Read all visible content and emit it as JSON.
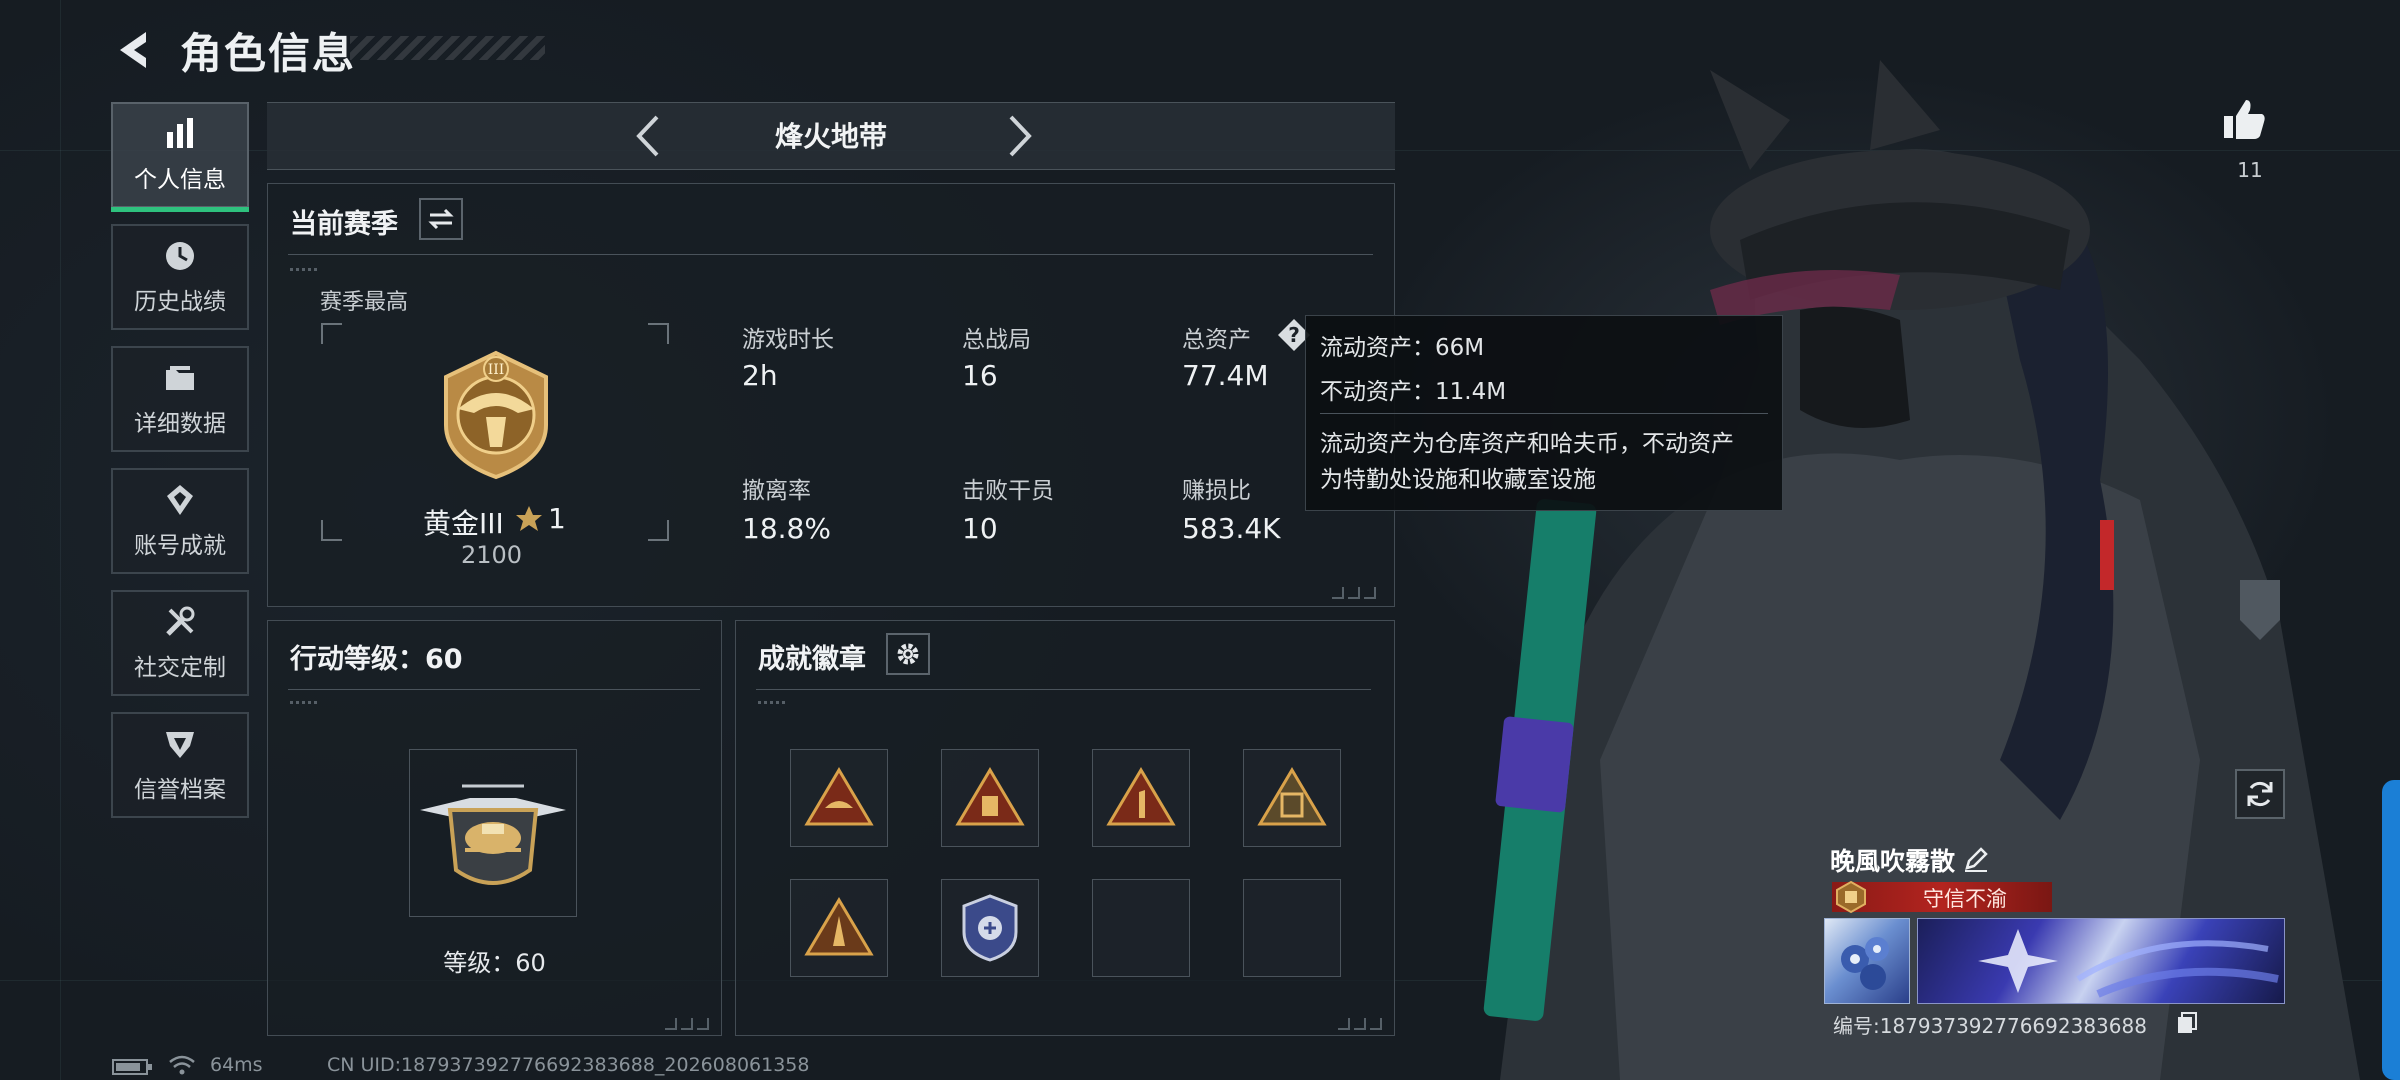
{
  "header": {
    "title": "角色信息"
  },
  "sidebar": {
    "items": [
      {
        "label": "个人信息",
        "icon": "bar-chart-icon",
        "active": true
      },
      {
        "label": "历史战绩",
        "icon": "history-icon"
      },
      {
        "label": "详细数据",
        "icon": "folder-icon"
      },
      {
        "label": "账号成就",
        "icon": "achievement-icon"
      },
      {
        "label": "社交定制",
        "icon": "tools-icon"
      },
      {
        "label": "信誉档案",
        "icon": "reputation-icon"
      }
    ]
  },
  "mode": {
    "title": "烽火地带"
  },
  "season": {
    "title": "当前赛季",
    "best_label": "赛季最高",
    "rank_name": "黄金III",
    "rank_stars": "1",
    "rank_score": "2100",
    "stats": [
      {
        "label": "游戏时长",
        "value": "2h"
      },
      {
        "label": "总战局",
        "value": "16"
      },
      {
        "label": "总资产",
        "value": "77.4M"
      },
      {
        "label": "撤离率",
        "value": "18.8%"
      },
      {
        "label": "击败干员",
        "value": "10"
      },
      {
        "label": "赚损比",
        "value": "583.4K"
      }
    ]
  },
  "tooltip": {
    "liquid": "流动资产：66M",
    "fixed": "不动资产：11.4M",
    "desc_line1": "流动资产为仓库资产和哈夫币，不动资产",
    "desc_line2": "为特勤处设施和收藏室设施"
  },
  "level": {
    "title": "行动等级：60",
    "label": "等级：60"
  },
  "badges": {
    "title": "成就徽章"
  },
  "profile": {
    "likes": "11",
    "name": "晚風吹霧散",
    "title_badge": "守信不渝",
    "id": "编号:187937392776692383688"
  },
  "status": {
    "ping": "64ms",
    "uid": "CN UID:187937392776692383688_202608061358"
  },
  "colors": {
    "accent": "#2ec27e",
    "gold": "#c9a257",
    "title_red": "#b3241f"
  }
}
